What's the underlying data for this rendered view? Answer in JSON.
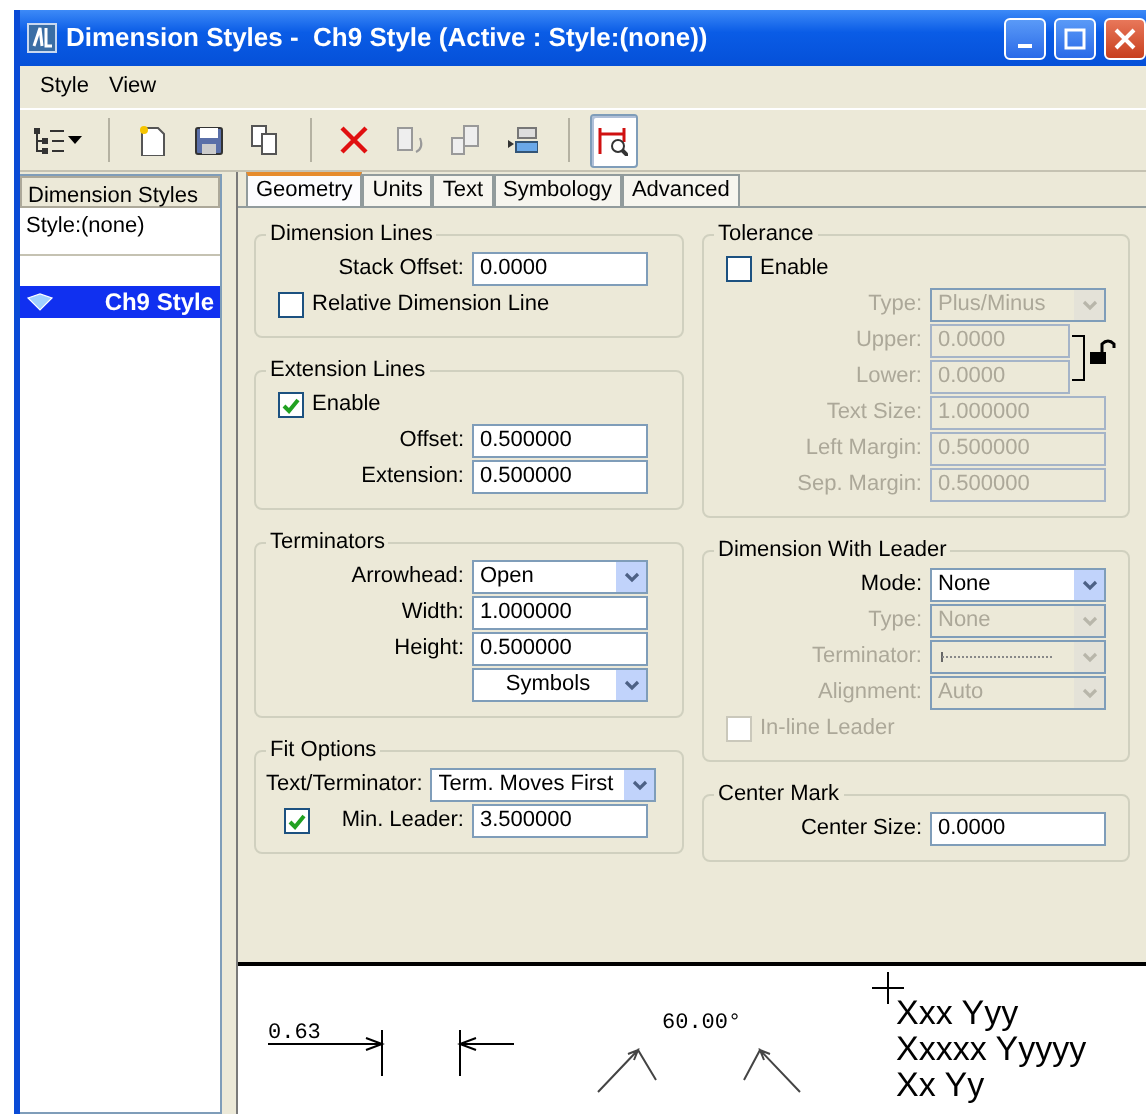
{
  "window": {
    "title": "Dimension Styles -  Ch9 Style (Active : Style:(none))"
  },
  "menu": [
    "Style",
    "View"
  ],
  "toolbar": [
    [
      {
        "kind": "tree",
        "pressed": false
      }
    ],
    [
      {
        "kind": "new",
        "pressed": false
      },
      {
        "kind": "save",
        "pressed": false
      },
      {
        "kind": "copy",
        "pressed": false
      }
    ],
    [
      {
        "kind": "delete",
        "pressed": false
      },
      {
        "kind": "update",
        "pressed": false
      },
      {
        "kind": "import",
        "pressed": false
      },
      {
        "kind": "export",
        "pressed": false
      }
    ],
    [
      {
        "kind": "preview",
        "pressed": true
      }
    ]
  ],
  "style_list": {
    "header": "Dimension Styles",
    "items": [
      {
        "label": "Style:(none)",
        "kind": "plain",
        "selected": false
      },
      {
        "label": "Ch9 Style",
        "kind": "style",
        "selected": true
      }
    ]
  },
  "tabs": [
    {
      "label": "Geometry",
      "selected": true
    },
    {
      "label": "Units",
      "selected": false
    },
    {
      "label": "Text",
      "selected": false
    },
    {
      "label": "Symbology",
      "selected": false
    },
    {
      "label": "Advanced",
      "selected": false
    }
  ],
  "groups_left": [
    {
      "title": "Dimension Lines",
      "rows": [
        {
          "kind": "field",
          "label": "Stack Offset:",
          "value": "0.0000",
          "disabled": false
        },
        {
          "kind": "checkbox",
          "label": "Relative Dimension Line",
          "checked": false,
          "disabled": false
        }
      ]
    },
    {
      "title": "Extension Lines",
      "rows": [
        {
          "kind": "checkbox",
          "label": "Enable",
          "checked": true,
          "disabled": false
        },
        {
          "kind": "field",
          "label": "Offset:",
          "value": "0.500000",
          "disabled": false
        },
        {
          "kind": "field",
          "label": "Extension:",
          "value": "0.500000",
          "disabled": false
        }
      ]
    },
    {
      "title": "Terminators",
      "rows": [
        {
          "kind": "select",
          "label": "Arrowhead:",
          "value": "Open",
          "disabled": false
        },
        {
          "kind": "field",
          "label": "Width:",
          "value": "1.000000",
          "disabled": false
        },
        {
          "kind": "field",
          "label": "Height:",
          "value": "0.500000",
          "disabled": false
        },
        {
          "kind": "select",
          "value": "Symbols",
          "disabled": false
        }
      ]
    },
    {
      "title": "Fit Options",
      "rows": [
        {
          "kind": "select-wide",
          "label": "Text/Terminator:",
          "value": "Term. Moves First",
          "disabled": false
        },
        {
          "kind": "check-field",
          "label": "Min. Leader:",
          "value": "3.500000",
          "checked": true,
          "disabled": false
        }
      ]
    }
  ],
  "groups_right": [
    {
      "title": "Tolerance",
      "rows": [
        {
          "kind": "checkbox",
          "label": "Enable",
          "checked": false,
          "disabled": false
        },
        {
          "kind": "select",
          "label": "Type:",
          "value": "Plus/Minus",
          "disabled": true
        },
        {
          "kind": "linked-fields",
          "locked": false,
          "disabled": true,
          "fields": [
            {
              "label": "Upper:",
              "value": "0.0000"
            },
            {
              "label": "Lower:",
              "value": "0.0000"
            }
          ]
        },
        {
          "kind": "field",
          "label": "Text Size:",
          "value": "1.000000",
          "disabled": true
        },
        {
          "kind": "field",
          "label": "Left Margin:",
          "value": "0.500000",
          "disabled": true
        },
        {
          "kind": "field",
          "label": "Sep. Margin:",
          "value": "0.500000",
          "disabled": true
        }
      ]
    },
    {
      "title": "Dimension With Leader",
      "rows": [
        {
          "kind": "select",
          "label": "Mode:",
          "value": "None",
          "disabled": false
        },
        {
          "kind": "select",
          "label": "Type:",
          "value": "None",
          "disabled": true
        },
        {
          "kind": "line-select",
          "label": "Terminator:",
          "disabled": true
        },
        {
          "kind": "select",
          "label": "Alignment:",
          "value": "Auto",
          "disabled": true
        },
        {
          "kind": "checkbox",
          "label": "In-line Leader",
          "checked": false,
          "disabled": true
        }
      ]
    },
    {
      "title": "Center Mark",
      "rows": [
        {
          "kind": "field",
          "label": "Center Size:",
          "value": "0.0000",
          "disabled": false
        }
      ]
    }
  ],
  "preview": {
    "linear_value": "0.63",
    "angle_value": "60.00°",
    "text_lines": [
      "Xxx Yyy",
      "Xxxxx Yyyyy",
      "Xx Yy"
    ]
  }
}
